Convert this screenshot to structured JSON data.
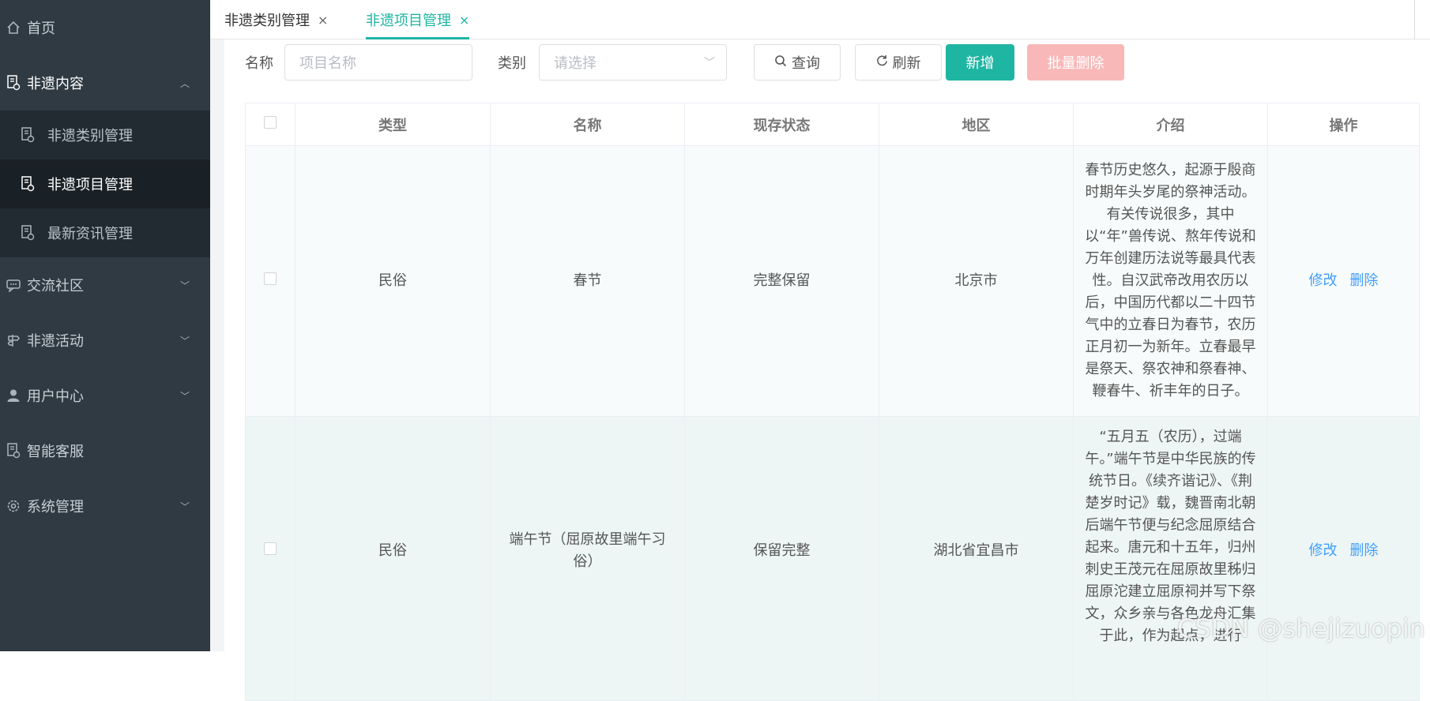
{
  "sidebar": {
    "home": "首页",
    "content_group": "非遗内容",
    "content_items": [
      "非遗类别管理",
      "非遗项目管理",
      "最新资讯管理"
    ],
    "community": "交流社区",
    "activities": "非遗活动",
    "user_center": "用户中心",
    "service": "智能客服",
    "system": "系统管理"
  },
  "tabs": [
    {
      "label": "非遗类别管理",
      "close": "×"
    },
    {
      "label": "非遗项目管理",
      "close": "×"
    }
  ],
  "toolbar": {
    "name_label": "名称",
    "name_placeholder": "项目名称",
    "category_label": "类别",
    "category_placeholder": "请选择",
    "query": "查询",
    "refresh": "刷新",
    "add": "新增",
    "batch_delete": "批量删除"
  },
  "table": {
    "headers": [
      "类型",
      "名称",
      "现存状态",
      "地区",
      "介绍",
      "操作"
    ],
    "rows": [
      {
        "type": "民俗",
        "name": "春节",
        "status": "完整保留",
        "region": "北京市",
        "intro": "春节历史悠久，起源于殷商时期年头岁尾的祭神活动。有关传说很多，其中以“年”兽传说、熬年传说和万年创建历法说等最具代表性。自汉武帝改用农历以后，中国历代都以二十四节气中的立春日为春节，农历正月初一为新年。立春最早是祭天、祭农神和祭春神、鞭春牛、祈丰年的日子。",
        "edit": "修改",
        "delete": "删除"
      },
      {
        "type": "民俗",
        "name": "端午节（屈原故里端午习俗）",
        "status": "保留完整",
        "region": "湖北省宜昌市",
        "intro": "“五月五（农历），过端午。”端午节是中华民族的传统节日。《续齐谐记》、《荆楚岁时记》载，魏晋南北朝后端午节便与纪念屈原结合起来。唐元和十五年，归州刺史王茂元在屈原故里秭归屈原沱建立屈原祠并写下祭文，众乡亲与各色龙舟汇集于此，作为起点，进行",
        "edit": "修改",
        "delete": "删除"
      }
    ]
  },
  "watermark": "CSDN @shejizuopin"
}
